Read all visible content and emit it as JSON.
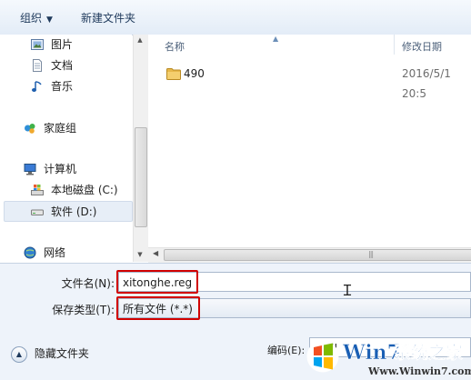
{
  "toolbar": {
    "organize_label": "组织",
    "new_folder_label": "新建文件夹"
  },
  "nav": {
    "items": [
      {
        "label": "图片"
      },
      {
        "label": "文档"
      },
      {
        "label": "音乐"
      },
      {
        "label": "家庭组"
      },
      {
        "label": "计算机"
      },
      {
        "label": "本地磁盘 (C:)"
      },
      {
        "label": "软件 (D:)"
      },
      {
        "label": "网络"
      }
    ],
    "selected_index": 6
  },
  "file_list": {
    "columns": [
      "名称",
      "修改日期"
    ],
    "rows": [
      {
        "name": "490",
        "modified": "2016/5/1 20:5"
      }
    ]
  },
  "form": {
    "filename_label": "文件名(N):",
    "filename_value": "xitonghe.reg",
    "filetype_label": "保存类型(T):",
    "filetype_value": "所有文件  (*.*)",
    "encoding_label": "编码(E):",
    "encoding_value": "ANSI"
  },
  "footer": {
    "hide_folders_label": "隐藏文件夹"
  },
  "watermark": {
    "brand_latin": "Win7",
    "brand_cn": "系统之家",
    "url": "Www.Winwin7.com"
  },
  "colors": {
    "highlight_red": "#d10000",
    "toolbar_text": "#1e395b",
    "selection_bg": "#e7eef7"
  }
}
